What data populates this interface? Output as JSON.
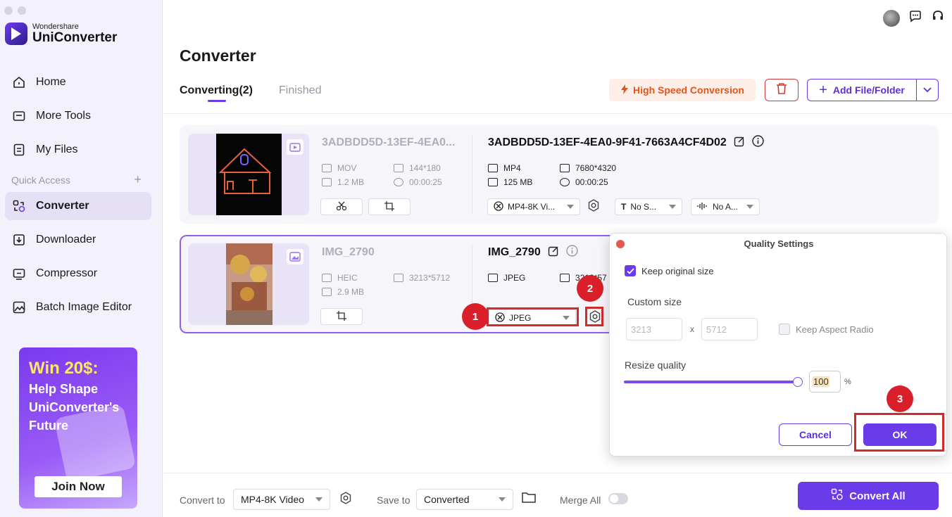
{
  "app": {
    "brand": "Wondershare",
    "product": "UniConverter"
  },
  "sidebar": {
    "items": [
      {
        "label": "Home",
        "icon": "home-icon"
      },
      {
        "label": "More Tools",
        "icon": "tools-icon"
      },
      {
        "label": "My Files",
        "icon": "files-icon"
      },
      {
        "label": "Converter",
        "icon": "converter-icon",
        "active": true
      },
      {
        "label": "Downloader",
        "icon": "downloader-icon"
      },
      {
        "label": "Compressor",
        "icon": "compressor-icon"
      },
      {
        "label": "Batch Image Editor",
        "icon": "image-editor-icon"
      }
    ],
    "quick_access": "Quick Access",
    "promo": {
      "headline": "Win 20$:",
      "body": "Help Shape UniConverter's Future",
      "button": "Join Now"
    }
  },
  "header": {
    "title": "Converter",
    "tabs": [
      {
        "label": "Converting(2)"
      },
      {
        "label": "Finished"
      }
    ],
    "high_speed": "High Speed Conversion",
    "add_file": "Add File/Folder"
  },
  "items": [
    {
      "src_name": "3ADBDD5D-13EF-4EA0...",
      "src_format": "MOV",
      "src_res": "144*180",
      "src_size": "1.2 MB",
      "src_duration": "00:00:25",
      "dst_name": "3ADBDD5D-13EF-4EA0-9F41-7663A4CF4D02",
      "dst_format": "MP4",
      "dst_res": "7680*4320",
      "dst_size": "125 MB",
      "dst_duration": "00:00:25",
      "format_select": "MP4-8K Vi...",
      "subtitle_select": "No S...",
      "audio_select": "No A..."
    },
    {
      "src_name": "IMG_2790",
      "src_format": "HEIC",
      "src_res": "3213*5712",
      "src_size": "2.9 MB",
      "dst_name": "IMG_2790",
      "dst_format": "JPEG",
      "dst_res": "3213*57",
      "format_select": "JPEG"
    }
  ],
  "annotations": {
    "b1": "1",
    "b2": "2",
    "b3": "3"
  },
  "bottom": {
    "convert_to_label": "Convert to",
    "convert_to_value": "MP4-8K Video",
    "save_to_label": "Save to",
    "save_to_value": "Converted",
    "merge_label": "Merge All",
    "convert_all": "Convert All"
  },
  "dialog": {
    "title": "Quality Settings",
    "keep_original": "Keep original size",
    "custom_size": "Custom size",
    "width_placeholder": "3213",
    "height_placeholder": "5712",
    "times": "x",
    "keep_aspect": "Keep Aspect Radio",
    "resize_quality": "Resize quality",
    "quality_value": "100",
    "percent": "%",
    "quality_level": 1.0,
    "cancel": "Cancel",
    "ok": "OK"
  },
  "colors": {
    "accent": "#6a3be8",
    "highlight": "#d12b2b",
    "badge": "#d9202a",
    "speed": "#e2561c"
  }
}
